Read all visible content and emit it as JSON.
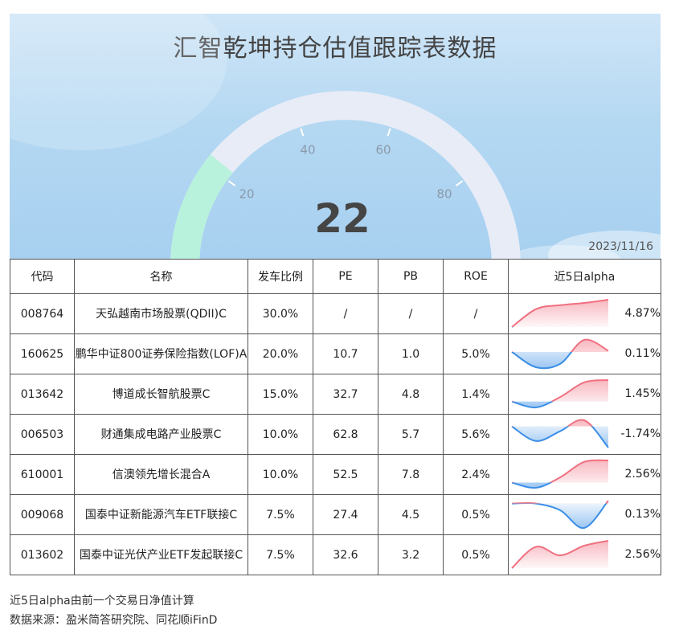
{
  "title": "汇智乾坤持仓估值跟踪表数据",
  "date": "2023/11/16",
  "gauge": {
    "value": 22,
    "display": "22",
    "min": 0,
    "max": 100,
    "ticks": [
      "0",
      "20",
      "40",
      "60",
      "80",
      "100"
    ]
  },
  "colors": {
    "gauge_fill": "#b8f2dc",
    "gauge_track": "#e8ecf7",
    "positive": "#f07080",
    "negative": "#3a8ee6"
  },
  "table": {
    "headers": [
      "代码",
      "名称",
      "发车比例",
      "PE",
      "PB",
      "ROE",
      "近5日alpha"
    ],
    "rows": [
      {
        "code": "008764",
        "name": "天弘越南市场股票(QDII)C",
        "ratio": "30.0%",
        "pe": "/",
        "pb": "/",
        "roe": "/",
        "alpha": "4.87%"
      },
      {
        "code": "160625",
        "name": "鹏华中证800证券保险指数(LOF)A",
        "ratio": "20.0%",
        "pe": "10.7",
        "pb": "1.0",
        "roe": "5.0%",
        "alpha": "0.11%"
      },
      {
        "code": "013642",
        "name": "博道成长智航股票C",
        "ratio": "15.0%",
        "pe": "32.7",
        "pb": "4.8",
        "roe": "1.4%",
        "alpha": "1.45%"
      },
      {
        "code": "006503",
        "name": "财通集成电路产业股票C",
        "ratio": "10.0%",
        "pe": "62.8",
        "pb": "5.7",
        "roe": "5.6%",
        "alpha": "-1.74%"
      },
      {
        "code": "610001",
        "name": "信澳领先增长混合A",
        "ratio": "10.0%",
        "pe": "52.5",
        "pb": "7.8",
        "roe": "2.4%",
        "alpha": "2.56%"
      },
      {
        "code": "009068",
        "name": "国泰中证新能源汽车ETF联接C",
        "ratio": "7.5%",
        "pe": "27.4",
        "pb": "4.5",
        "roe": "0.5%",
        "alpha": "0.13%"
      },
      {
        "code": "013602",
        "name": "国泰中证光伏产业ETF发起联接C",
        "ratio": "7.5%",
        "pe": "32.6",
        "pb": "3.2",
        "roe": "0.5%",
        "alpha": "2.56%"
      }
    ]
  },
  "chart_data": {
    "type": "gauge",
    "title": "汇智乾坤持仓估值跟踪表数据",
    "value": 22,
    "range": [
      0,
      100
    ],
    "ticks": [
      0,
      20,
      40,
      60,
      80,
      100
    ],
    "sparklines": [
      {
        "name": "008764",
        "values": [
          0.0,
          3.2,
          3.9,
          4.3,
          4.87
        ]
      },
      {
        "name": "160625",
        "values": [
          0.0,
          -1.4,
          -1.1,
          1.1,
          0.11
        ]
      },
      {
        "name": "013642",
        "values": [
          0.0,
          -0.4,
          0.3,
          1.3,
          1.45
        ]
      },
      {
        "name": "006503",
        "values": [
          0.0,
          -1.2,
          -0.4,
          0.5,
          -1.74
        ]
      },
      {
        "name": "610001",
        "values": [
          0.0,
          -0.6,
          0.6,
          2.4,
          2.56
        ]
      },
      {
        "name": "009068",
        "values": [
          0.0,
          0.0,
          -0.3,
          -1.1,
          0.13
        ]
      },
      {
        "name": "013602",
        "values": [
          0.0,
          2.0,
          1.2,
          2.1,
          2.56
        ]
      }
    ]
  },
  "footnotes": [
    "近5日alpha由前一个交易日净值计算",
    "数据来源：盈米简答研究院、同花顺iFinD"
  ]
}
